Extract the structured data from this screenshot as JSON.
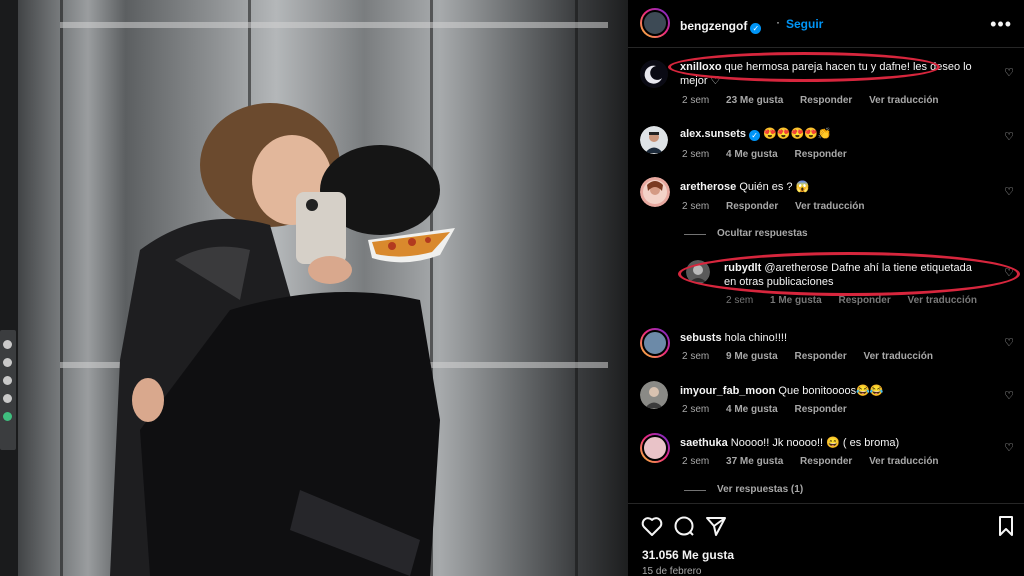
{
  "post": {
    "image_alt": "",
    "author": "bengzengof",
    "follow_label": "Seguir",
    "more_label": "•••"
  },
  "comments": [
    {
      "user": "xnilloxo",
      "text_line1": "que hermosa pareja hacen tu y dafne! les deseo lo",
      "text_line2": "mejor ♡",
      "time": "2 sem",
      "likes": "23 Me gusta",
      "reply": "Responder",
      "translate": "Ver traducción"
    },
    {
      "user": "alex.sunsets",
      "text_line1": "😍😍😍😍👏",
      "time": "2 sem",
      "likes": "4 Me gusta",
      "reply": "Responder"
    },
    {
      "user": "aretherose",
      "text_line1": "Quién es ? 😱",
      "time": "2 sem",
      "reply": "Responder",
      "translate": "Ver traducción",
      "hide_replies": "Ocultar respuestas",
      "replies": [
        {
          "user": "rubydlt",
          "text_line1": "@aretherose Dafne ahí la tiene etiquetada",
          "text_line2": "en otras publicaciones",
          "time": "2 sem",
          "likes": "1 Me gusta",
          "reply": "Responder",
          "translate": "Ver traducción"
        }
      ]
    },
    {
      "user": "sebusts",
      "text_line1": "hola chino!!!!",
      "time": "2 sem",
      "likes": "9 Me gusta",
      "reply": "Responder",
      "translate": "Ver traducción"
    },
    {
      "user": "imyour_fab_moon",
      "text_line1": "Que bonitoooos😂😂",
      "time": "2 sem",
      "likes": "4 Me gusta",
      "reply": "Responder"
    },
    {
      "user": "saethuka",
      "text_line1": "Noooo!! Jk noooo!! 😄 ( es broma)",
      "time": "2 sem",
      "likes": "37 Me gusta",
      "reply": "Responder",
      "translate": "Ver traducción",
      "view_replies": "Ver respuestas (1)"
    }
  ],
  "footer": {
    "likes_count": "31.056 Me gusta",
    "date": "15 de febrero"
  },
  "colors": {
    "background": "#000000",
    "link_blue": "#0095f6",
    "annotation_red": "#d7263d",
    "secondary_text": "#a8a8a8"
  },
  "icons": [
    "verified-icon",
    "more-options-icon",
    "heart-icon",
    "comment-icon",
    "share-icon",
    "bookmark-icon"
  ]
}
